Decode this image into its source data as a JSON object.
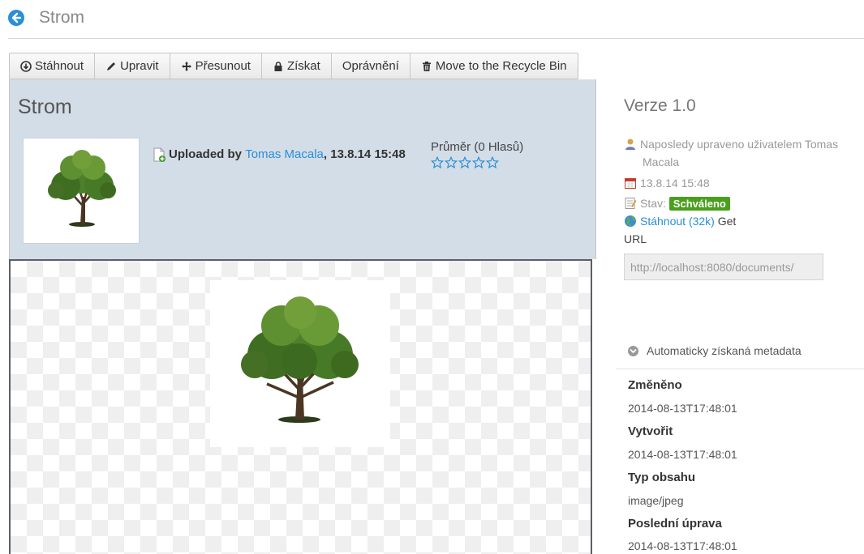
{
  "header": {
    "title": "Strom"
  },
  "toolbar": {
    "download": "Stáhnout",
    "edit": "Upravit",
    "move": "Přesunout",
    "checkout": "Získat",
    "permissions": "Oprávnění",
    "recycle": "Move to the Recycle Bin"
  },
  "document": {
    "title": "Strom",
    "uploaded_by_prefix": "Uploaded by ",
    "author": "Tomas Macala",
    "date_suffix": ", 13.8.14 15:48",
    "rating_label": "Průměr (0 Hlasů)",
    "rating_value": 0,
    "rating_max": 5
  },
  "sidebar": {
    "version": "Verze 1.0",
    "modified_by_line1": "Naposledy upraveno uživatelem Tomas",
    "modified_by_line2": "Macala",
    "date": "13.8.14 15:48",
    "status_label": "Stav:",
    "status_value": "Schváleno",
    "download_link": "Stáhnout (32k)",
    "get_label": "Get",
    "url_label": "URL",
    "url_value": "http://localhost:8080/documents/"
  },
  "metadata": {
    "section_title": "Automaticky získaná metadata",
    "fields": [
      {
        "key": "Změněno",
        "value": "2014-08-13T17:48:01"
      },
      {
        "key": "Vytvořit",
        "value": "2014-08-13T17:48:01"
      },
      {
        "key": "Typ obsahu",
        "value": "image/jpeg"
      },
      {
        "key": "Poslední úprava",
        "value": "2014-08-13T17:48:01"
      }
    ]
  },
  "colors": {
    "accent": "#2a8fd6",
    "status": "#4a9f1c",
    "header_bg": "#d3dde7"
  },
  "icons": [
    "back-arrow-icon",
    "download-icon",
    "pencil-icon",
    "move-arrows-icon",
    "lock-icon",
    "trash-icon",
    "file-add-icon",
    "star-icon",
    "user-icon",
    "calendar-icon",
    "note-icon",
    "globe-icon",
    "chevron-down-icon"
  ]
}
